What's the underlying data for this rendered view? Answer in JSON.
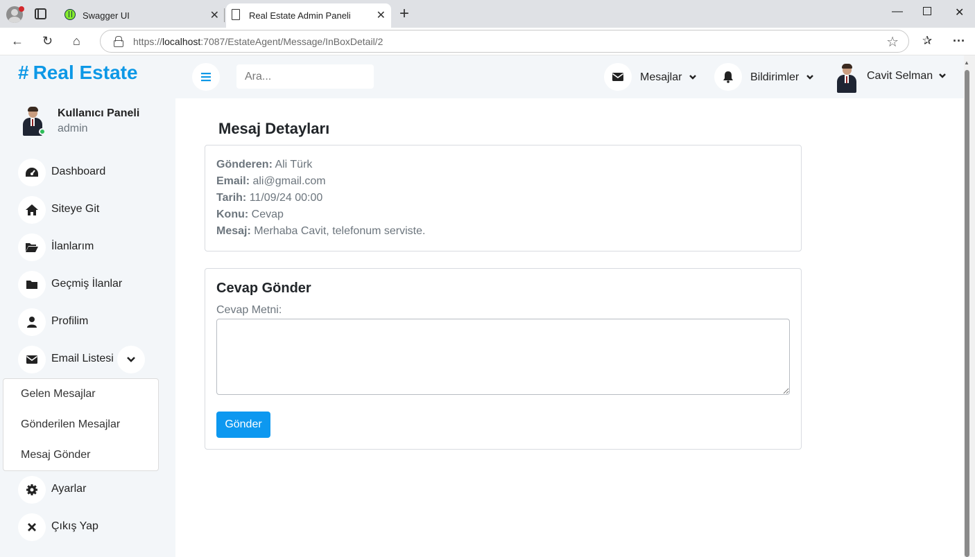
{
  "browser": {
    "tabs": [
      {
        "title": "Swagger UI"
      },
      {
        "title": "Real Estate Admin Paneli"
      }
    ],
    "url_prefix": "https://",
    "url_host": "localhost",
    "url_rest": ":7087/EstateAgent/Message/InBoxDetail/2"
  },
  "brand": {
    "hash": "#",
    "name": "Real Estate"
  },
  "user_panel": {
    "title": "Kullanıcı Paneli",
    "role": "admin"
  },
  "sidebar": {
    "items": [
      {
        "label": "Dashboard",
        "icon": "dashboard-gauge-icon"
      },
      {
        "label": "Siteye Git",
        "icon": "home-icon"
      },
      {
        "label": "İlanlarım",
        "icon": "folder-open-icon"
      },
      {
        "label": "Geçmiş İlanlar",
        "icon": "folder-icon"
      },
      {
        "label": "Profilim",
        "icon": "user-icon"
      },
      {
        "label": "Email Listesi",
        "icon": "envelope-icon"
      },
      {
        "label": "Ayarlar",
        "icon": "gear-icon"
      },
      {
        "label": "Çıkış Yap",
        "icon": "close-icon"
      }
    ],
    "email_submenu": [
      "Gelen Mesajlar",
      "Gönderilen Mesajlar",
      "Mesaj Gönder"
    ]
  },
  "topbar": {
    "search_placeholder": "Ara...",
    "messages_label": "Mesajlar",
    "notifications_label": "Bildirimler",
    "user_name": "Cavit Selman"
  },
  "main": {
    "page_title": "Mesaj Detayları",
    "details": [
      {
        "key": "Gönderen:",
        "value": "Ali Türk"
      },
      {
        "key": "Email:",
        "value": "ali@gmail.com"
      },
      {
        "key": "Tarih:",
        "value": "11/09/24 00:00"
      },
      {
        "key": "Konu:",
        "value": "Cevap"
      },
      {
        "key": "Mesaj:",
        "value": "Merhaba Cavit, telefonum serviste."
      }
    ],
    "reply": {
      "title": "Cevap Gönder",
      "field_label": "Cevap Metni:",
      "value": "",
      "button": "Gönder"
    }
  },
  "colors": {
    "accent": "#0d98e6",
    "button": "#0d98f0",
    "sidebar_bg": "#f3f6f9",
    "online": "#2ebd59"
  }
}
